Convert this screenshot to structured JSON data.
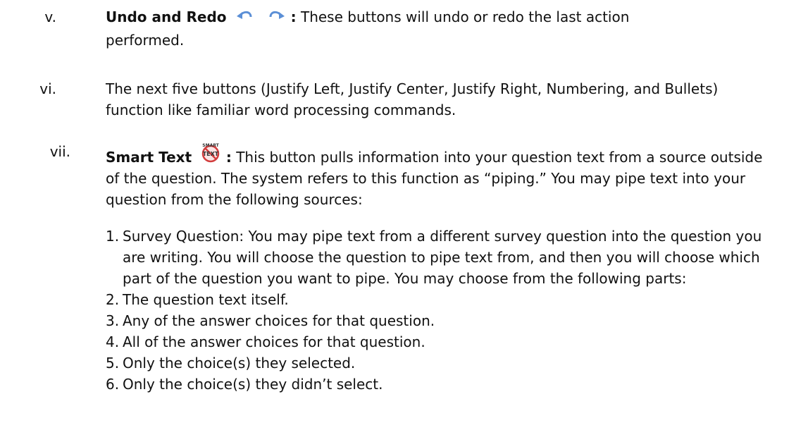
{
  "items": [
    {
      "numeral": "v.",
      "heading": "Undo and Redo",
      "colon": ":",
      "text_line1": " These buttons will undo or redo the last action",
      "text_line2": "performed.",
      "icons": [
        "undo-arrow-icon",
        "redo-arrow-icon"
      ]
    },
    {
      "numeral": "vi.",
      "text": "The next five buttons (Justify Left, Justify Center, Justify Right, Numbering, and Bullets) function like familiar word processing commands."
    },
    {
      "numeral": "vii.",
      "heading": "Smart Text",
      "colon": ":",
      "icon": "smart-text-icon",
      "icon_label_top": "SMART",
      "icon_label_bottom": "TEXT",
      "text": " This button pulls information into your question text from a source outside of the question. The system refers to this function as “piping.” You may pipe text into your question from the following sources:"
    }
  ],
  "sublist": [
    {
      "n": "1.",
      "text": "Survey Question: You may pipe text from a different survey question into the question you are writing. You will choose the question to pipe text from, and then you will choose which part of the question you want to pipe. You may choose from the following parts:"
    },
    {
      "n": "2.",
      "text": "The question text itself."
    },
    {
      "n": "3.",
      "text": "Any of the answer choices for that question."
    },
    {
      "n": "4.",
      "text": "All of the answer choices for that question."
    },
    {
      "n": "5.",
      "text": "Only the choice(s) they selected."
    },
    {
      "n": "6.",
      "text": "Only the choice(s) they didn’t select."
    }
  ],
  "colors": {
    "text": "#111111",
    "undo_icon": "#5b8fd6",
    "redo_icon": "#5b8fd6",
    "smart_text_ring": "#d23c3c"
  }
}
